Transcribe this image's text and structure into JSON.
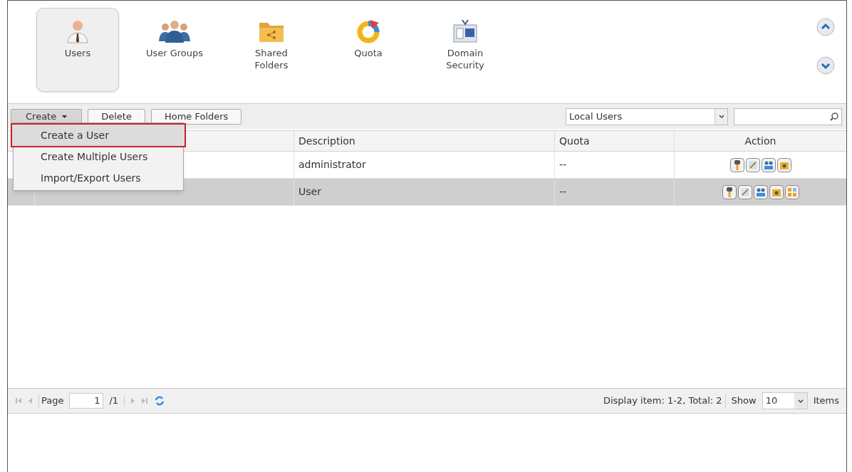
{
  "nav": [
    {
      "label": "Users",
      "kind": "user",
      "selected": true
    },
    {
      "label": "User Groups",
      "kind": "group",
      "selected": false
    },
    {
      "label": "Shared\nFolders",
      "kind": "folder",
      "selected": false
    },
    {
      "label": "Quota",
      "kind": "quota",
      "selected": false
    },
    {
      "label": "Domain\nSecurity",
      "kind": "domain",
      "selected": false
    }
  ],
  "toolbar": {
    "buttons": [
      {
        "label": "Create",
        "kind": "menu"
      },
      {
        "label": "Delete",
        "kind": "plain"
      },
      {
        "label": "Home Folders",
        "kind": "plain"
      }
    ],
    "filter": "Local Users"
  },
  "menu": [
    {
      "label": "Create a User",
      "selected": true
    },
    {
      "label": "Create Multiple Users",
      "selected": false
    },
    {
      "label": "Import/Export Users",
      "selected": false
    }
  ],
  "table": {
    "columns": [
      "Description",
      "Quota",
      "Action"
    ],
    "rows": [
      {
        "description": "administrator",
        "quota": "--",
        "selected": false,
        "actions": [
          {
            "kind": "key"
          },
          {
            "kind": "edit"
          },
          {
            "kind": "group"
          },
          {
            "kind": "folder"
          }
        ]
      },
      {
        "description": "User",
        "quota": "--",
        "selected": true,
        "actions": [
          {
            "kind": "key"
          },
          {
            "kind": "edit"
          },
          {
            "kind": "group"
          },
          {
            "kind": "folder"
          },
          {
            "kind": "apps"
          }
        ]
      }
    ]
  },
  "pager": {
    "page_label": "Page",
    "page": "1",
    "of": "/1",
    "display": "Display item: 1-2, Total: 2",
    "show_label": "Show",
    "show": "10",
    "items_label": "Items"
  }
}
